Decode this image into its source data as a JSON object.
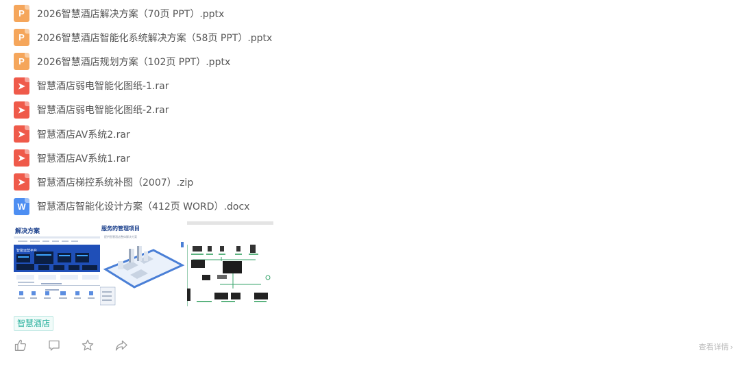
{
  "files": [
    {
      "type": "ppt",
      "icon": "ppt-file-icon",
      "glyph": "P",
      "name": "2026智慧酒店解决方案（70页 PPT）.pptx"
    },
    {
      "type": "ppt",
      "icon": "ppt-file-icon",
      "glyph": "P",
      "name": "2026智慧酒店智能化系统解决方案（58页 PPT）.pptx"
    },
    {
      "type": "ppt",
      "icon": "ppt-file-icon",
      "glyph": "P",
      "name": "2026智慧酒店规划方案（102页 PPT）.pptx"
    },
    {
      "type": "rar",
      "icon": "archive-file-icon",
      "glyph": "➤",
      "name": "智慧酒店弱电智能化图纸-1.rar"
    },
    {
      "type": "rar",
      "icon": "archive-file-icon",
      "glyph": "➤",
      "name": "智慧酒店弱电智能化图纸-2.rar"
    },
    {
      "type": "rar",
      "icon": "archive-file-icon",
      "glyph": "➤",
      "name": "智慧酒店AV系统2.rar"
    },
    {
      "type": "rar",
      "icon": "archive-file-icon",
      "glyph": "➤",
      "name": "智慧酒店AV系统1.rar"
    },
    {
      "type": "rar",
      "icon": "archive-file-icon",
      "glyph": "➤",
      "name": "智慧酒店梯控系统补图（2007）.zip"
    },
    {
      "type": "doc",
      "icon": "word-file-icon",
      "glyph": "W",
      "name": "智慧酒店智能化设计方案（412页 WORD）.docx"
    }
  ],
  "previews": {
    "p1": {
      "title": "解决方案",
      "subtitle": "智能运营平台"
    },
    "p2": {
      "title": "服务的管理项目",
      "subtitle": "提供智慧酒店整体解决方案"
    }
  },
  "tag": "智慧酒店",
  "actions": {
    "like": "thumbs-up-icon",
    "comment": "comment-icon",
    "favorite": "star-icon",
    "share": "share-icon"
  },
  "details_label": "查看详情",
  "colors": {
    "ppt": "#f5a65b",
    "rar": "#ef5a4a",
    "doc": "#4d8ef2",
    "tag": "#2eb3a0"
  }
}
